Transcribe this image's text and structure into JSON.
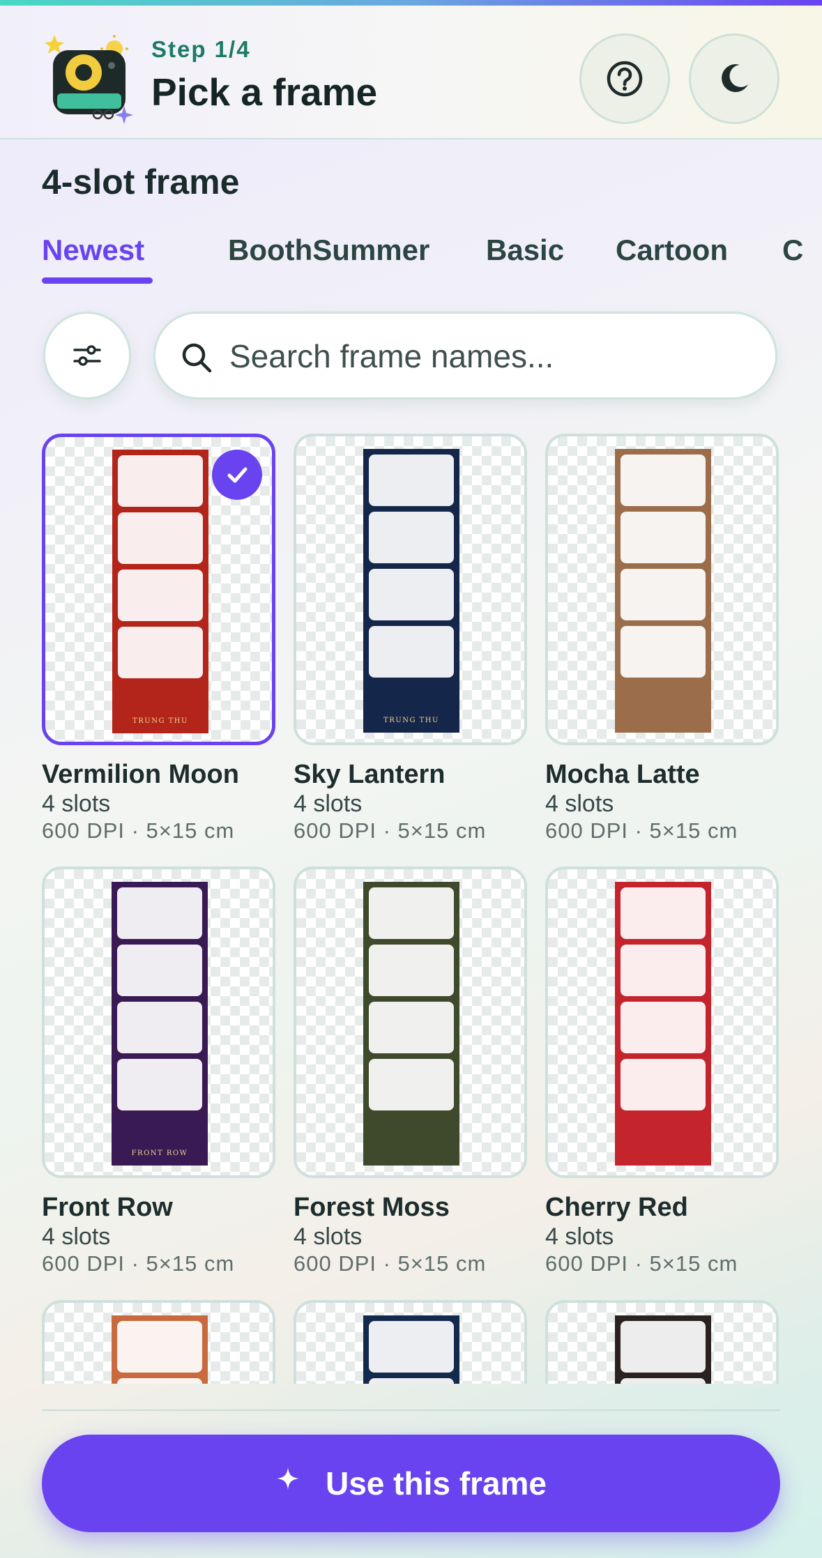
{
  "header": {
    "step": "Step 1/4",
    "title": "Pick a frame",
    "help_icon": "help-circle-icon",
    "theme_icon": "moon-icon"
  },
  "section_title": "4-slot frame",
  "tabs": [
    {
      "label": "Newest",
      "active": true
    },
    {
      "label": "BoothSummer",
      "active": false
    },
    {
      "label": "Basic",
      "active": false
    },
    {
      "label": "Cartoon",
      "active": false
    },
    {
      "label": "C",
      "active": false
    }
  ],
  "search": {
    "placeholder": "Search frame names...",
    "value": ""
  },
  "frames": [
    {
      "name": "Vermilion Moon",
      "slots": "4 slots",
      "meta": "600 DPI · 5×15 cm",
      "color": "#b3241a",
      "selected": true,
      "caption": "TRUNG THU"
    },
    {
      "name": "Sky Lantern",
      "slots": "4 slots",
      "meta": "600 DPI · 5×15 cm",
      "color": "#14264a",
      "selected": false,
      "caption": "TRUNG THU"
    },
    {
      "name": "Mocha Latte",
      "slots": "4 slots",
      "meta": "600 DPI · 5×15 cm",
      "color": "#9b6d4b",
      "selected": false
    },
    {
      "name": "Front Row",
      "slots": "4 slots",
      "meta": "600 DPI · 5×15 cm",
      "color": "#3a1a55",
      "selected": false,
      "caption": "FRONT ROW"
    },
    {
      "name": "Forest Moss",
      "slots": "4 slots",
      "meta": "600 DPI · 5×15 cm",
      "color": "#3f4a2c",
      "selected": false
    },
    {
      "name": "Cherry Red",
      "slots": "4 slots",
      "meta": "600 DPI · 5×15 cm",
      "color": "#c4242c",
      "selected": false
    },
    {
      "color": "#c96a3e"
    },
    {
      "color": "#13294d"
    },
    {
      "color": "#2a2220"
    }
  ],
  "cta": {
    "label": "Use this frame",
    "icon": "sparkle-icon"
  },
  "colors": {
    "accent": "#6a43f0",
    "teal": "#1c7a66"
  }
}
